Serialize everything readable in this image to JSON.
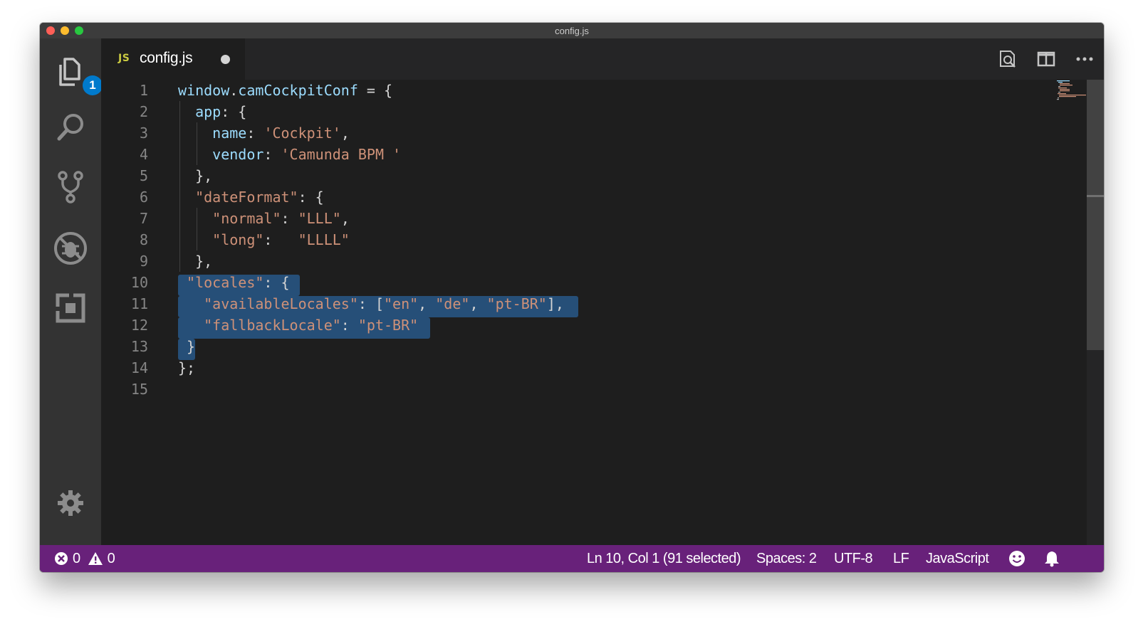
{
  "window": {
    "title": "config.js"
  },
  "tab": {
    "icon_text": "JS",
    "label": "config.js"
  },
  "activity": {
    "explorer_badge": "1"
  },
  "editor": {
    "lines": [
      {
        "n": "1"
      },
      {
        "n": "2"
      },
      {
        "n": "3"
      },
      {
        "n": "4"
      },
      {
        "n": "5"
      },
      {
        "n": "6"
      },
      {
        "n": "7"
      },
      {
        "n": "8"
      },
      {
        "n": "9"
      },
      {
        "n": "10"
      },
      {
        "n": "11"
      },
      {
        "n": "12"
      },
      {
        "n": "13"
      },
      {
        "n": "14"
      },
      {
        "n": "15"
      }
    ]
  },
  "status": {
    "errors": "0",
    "warnings": "0",
    "cursor": "Ln 10, Col 1 (91 selected)",
    "indent": "Spaces: 2",
    "encoding": "UTF-8",
    "eol": "LF",
    "language": "JavaScript"
  },
  "icons": {
    "explorer": "files-icon",
    "search": "search-icon",
    "scm": "source-control-icon",
    "debug": "debug-icon",
    "extensions": "extensions-icon",
    "settings": "gear-icon"
  },
  "colors": {
    "status_bar": "#68217a",
    "selection": "#264f78",
    "badge": "#007acc"
  }
}
